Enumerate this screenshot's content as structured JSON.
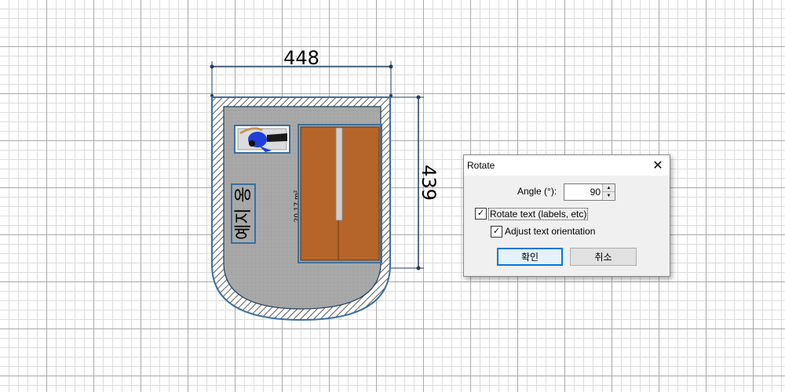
{
  "plan": {
    "width_dimension": "448",
    "depth_dimension": "439",
    "room_name": "예지 옹",
    "room_area": "20.17 m²"
  },
  "dialog": {
    "title": "Rotate",
    "angle_label": "Angle (°):",
    "angle_value": "90",
    "rotate_text_label": "Rotate text (labels, etc)",
    "rotate_text_checked": true,
    "adjust_orientation_label": "Adjust text orientation",
    "adjust_orientation_checked": true,
    "ok_label": "확인",
    "cancel_label": "취소"
  },
  "colors": {
    "wall_fill": "#ffffff",
    "wall_outline": "#3a6f9e",
    "floor": "#a8a8a8",
    "furniture_wood": "#b5652a",
    "selection": "#3a6f9e"
  }
}
